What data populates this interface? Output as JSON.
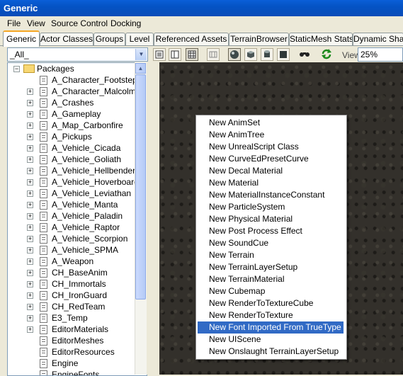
{
  "window": {
    "title": "Generic"
  },
  "menubar": {
    "items": [
      "File",
      "View",
      "Source Control",
      "Docking"
    ]
  },
  "tabs": [
    {
      "label": "Generic",
      "active": true
    },
    {
      "label": "Actor Classes"
    },
    {
      "label": "Groups"
    },
    {
      "label": "Level"
    },
    {
      "label": "Referenced Assets"
    },
    {
      "label": "TerrainBrowser"
    },
    {
      "label": "StaticMesh Stats"
    },
    {
      "label": "Dynamic Shad"
    }
  ],
  "toolbar": {
    "filter_value": "_All_",
    "view_label": "View",
    "zoom_value": "25%",
    "buttons": [
      "list-view-icon",
      "split-view-icon",
      "thumbnail-view-icon",
      "grid-icon",
      "sphere-preview-icon",
      "cube-preview-icon",
      "cylinder-preview-icon",
      "plane-preview-icon",
      "find-icon",
      "refresh-icon"
    ]
  },
  "tree": {
    "root": "Packages",
    "items": [
      {
        "label": "A_Character_Footsteps",
        "expandable": false
      },
      {
        "label": "A_Character_Malcolm",
        "expandable": true
      },
      {
        "label": "A_Crashes",
        "expandable": true
      },
      {
        "label": "A_Gameplay",
        "expandable": true
      },
      {
        "label": "A_Map_Carbonfire",
        "expandable": true
      },
      {
        "label": "A_Pickups",
        "expandable": true
      },
      {
        "label": "A_Vehicle_Cicada",
        "expandable": true
      },
      {
        "label": "A_Vehicle_Goliath",
        "expandable": true
      },
      {
        "label": "A_Vehicle_Hellbender",
        "expandable": true
      },
      {
        "label": "A_Vehicle_Hoverboard",
        "expandable": true
      },
      {
        "label": "A_Vehicle_Leviathan",
        "expandable": true
      },
      {
        "label": "A_Vehicle_Manta",
        "expandable": true
      },
      {
        "label": "A_Vehicle_Paladin",
        "expandable": true
      },
      {
        "label": "A_Vehicle_Raptor",
        "expandable": true
      },
      {
        "label": "A_Vehicle_Scorpion",
        "expandable": true
      },
      {
        "label": "A_Vehicle_SPMA",
        "expandable": true
      },
      {
        "label": "A_Weapon",
        "expandable": true
      },
      {
        "label": "CH_BaseAnim",
        "expandable": true
      },
      {
        "label": "CH_Immortals",
        "expandable": true
      },
      {
        "label": "CH_IronGuard",
        "expandable": true
      },
      {
        "label": "CH_RedTeam",
        "expandable": true
      },
      {
        "label": "E3_Temp",
        "expandable": true
      },
      {
        "label": "EditorMaterials",
        "expandable": true
      },
      {
        "label": "EditorMeshes",
        "expandable": false
      },
      {
        "label": "EditorResources",
        "expandable": false
      },
      {
        "label": "Engine",
        "expandable": false
      },
      {
        "label": "EngineFonts",
        "expandable": false
      }
    ]
  },
  "context_menu": {
    "items": [
      "New AnimSet",
      "New AnimTree",
      "New UnrealScript Class",
      "New CurveEdPresetCurve",
      "New Decal Material",
      "New Material",
      "New MaterialInstanceConstant",
      "New ParticleSystem",
      "New Physical Material",
      "New Post Process Effect",
      "New SoundCue",
      "New Terrain",
      "New TerrainLayerSetup",
      "New TerrainMaterial",
      "New Cubemap",
      "New RenderToTextureCube",
      "New RenderToTexture",
      "New Font Imported From TrueType",
      "New UIScene",
      "New Onslaught TerrainLayerSetup"
    ],
    "selected_index": 17
  },
  "colors": {
    "selection": "#316ac5",
    "title_bar": "#0453c4",
    "viewport": "#33302b"
  }
}
